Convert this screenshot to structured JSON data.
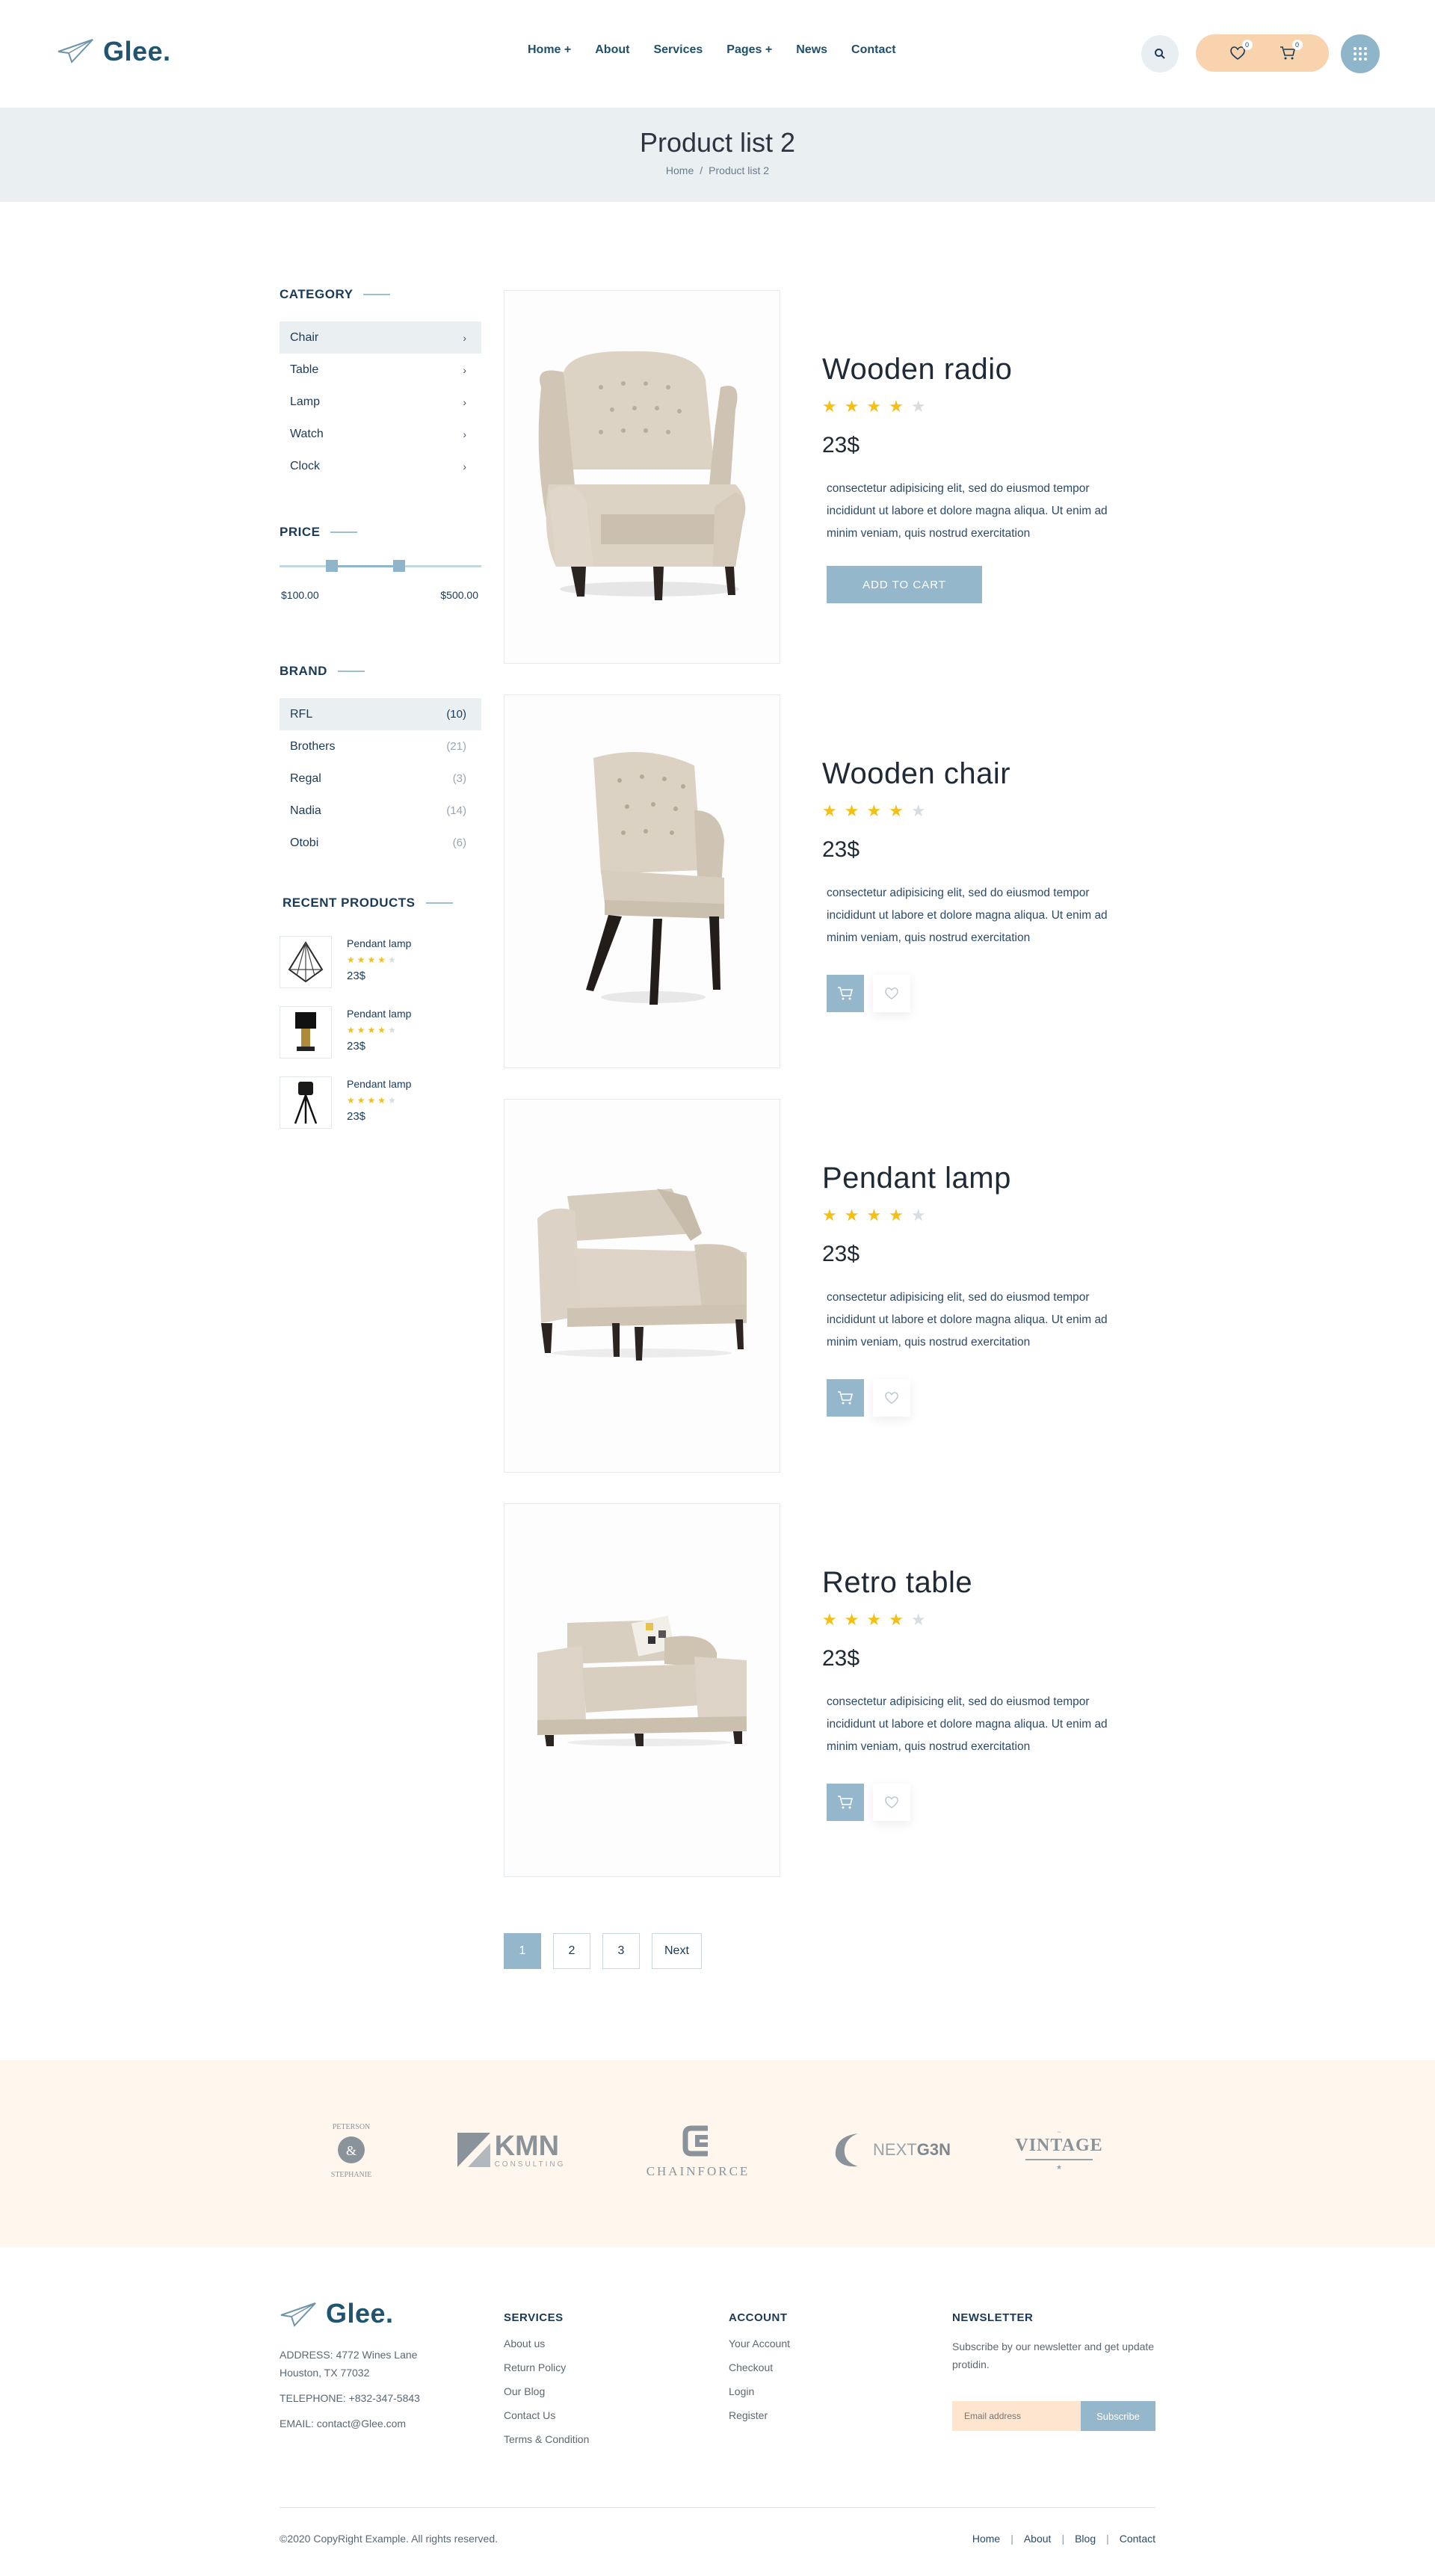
{
  "brand": {
    "name": "Glee."
  },
  "nav": [
    "Home +",
    "About",
    "Services",
    "Pages +",
    "News",
    "Contact"
  ],
  "header": {
    "wishlist_count": "0",
    "cart_count": "0"
  },
  "banner": {
    "title": "Product list 2",
    "breadcrumb_home": "Home",
    "breadcrumb_sep": "/",
    "breadcrumb_current": "Product list 2"
  },
  "sidebar": {
    "category_title": "CATEGORY",
    "categories": [
      "Chair",
      "Table",
      "Lamp",
      "Watch",
      "Clock"
    ],
    "price_title": "PRICE",
    "price_min": "$100.00",
    "price_max": "$500.00",
    "brand_title": "BRAND",
    "brands": [
      {
        "name": "RFL",
        "count": "(10)"
      },
      {
        "name": "Brothers",
        "count": "(21)"
      },
      {
        "name": "Regal",
        "count": "(3)"
      },
      {
        "name": "Nadia",
        "count": "(14)"
      },
      {
        "name": "Otobi",
        "count": "(6)"
      }
    ],
    "recent_title": "RECENT PRODUCTS",
    "recent": [
      {
        "name": "Pendant lamp",
        "price": "23$",
        "rating": 4
      },
      {
        "name": "Pendant lamp",
        "price": "23$",
        "rating": 4
      },
      {
        "name": "Pendant lamp",
        "price": "23$",
        "rating": 4
      }
    ]
  },
  "products": [
    {
      "name": "Wooden radio",
      "price": "23$",
      "rating": 4,
      "desc": "consectetur adipisicing elit, sed do eiusmod tempor incididunt ut labore et dolore magna aliqua. Ut enim ad minim veniam, quis nostrud exercitation",
      "button": "ADD TO CART"
    },
    {
      "name": "Wooden chair",
      "price": "23$",
      "rating": 4,
      "desc": "consectetur adipisicing elit, sed do eiusmod tempor incididunt ut labore et dolore magna aliqua. Ut enim ad minim veniam, quis nostrud exercitation"
    },
    {
      "name": "Pendant lamp",
      "price": "23$",
      "rating": 4,
      "desc": "consectetur adipisicing elit, sed do eiusmod tempor incididunt ut labore et dolore magna aliqua. Ut enim ad minim veniam, quis nostrud exercitation"
    },
    {
      "name": "Retro table",
      "price": "23$",
      "rating": 4,
      "desc": "consectetur adipisicing elit, sed do eiusmod tempor incididunt ut labore et dolore magna aliqua. Ut enim ad minim veniam, quis nostrud exercitation"
    }
  ],
  "pagination": [
    "1",
    "2",
    "3",
    "Next"
  ],
  "partner_logos": {
    "peterson_1": "PETERSON",
    "peterson_amp": "&",
    "peterson_2": "STEPHANIE",
    "kmn": "KMN",
    "kmn_sub": "CONSULTING",
    "chainforce": "CHAINFORCE",
    "nextgen_a": "NEXT",
    "nextgen_b": "G3N",
    "vintage": "VINTAGE"
  },
  "footer": {
    "address": "ADDRESS: 4772 Wines Lane",
    "address2": "Houston, TX 77032",
    "telephone": "TELEPHONE: +832-347-5843",
    "email": "EMAIL: contact@Glee.com",
    "services_title": "SERVICES",
    "services": [
      "About us",
      "Return Policy",
      "Our Blog",
      "Contact Us",
      "Terms & Condition"
    ],
    "account_title": "ACCOUNT",
    "account": [
      "Your Account",
      "Checkout",
      "Login",
      "Register"
    ],
    "newsletter_title": "NEWSLETTER",
    "newsletter_text": "Subscribe by our newsletter and get update protidin.",
    "newsletter_placeholder": "Email address",
    "subscribe": "Subscribe",
    "copyright": "©2020 CopyRight Example. All rights reserved.",
    "bottom_links": [
      "Home",
      "About",
      "Blog",
      "Contact"
    ]
  },
  "colors": {
    "accent": "#95b7cb",
    "peach": "#f9d3ae",
    "star": "#f4c017",
    "navy": "#1b3a57"
  }
}
